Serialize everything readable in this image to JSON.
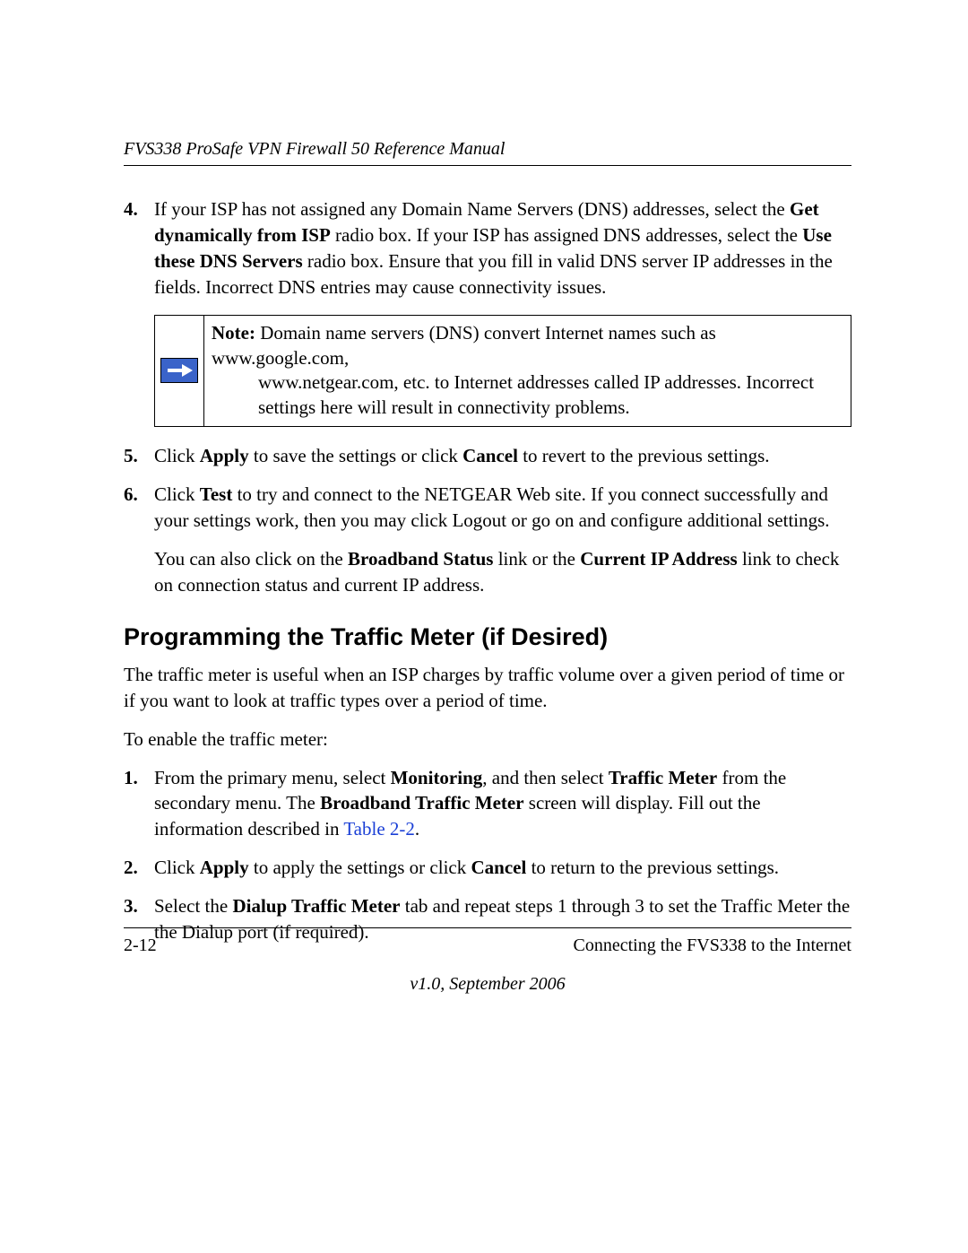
{
  "header": {
    "running_title": "FVS338 ProSafe VPN Firewall 50 Reference Manual"
  },
  "steps_a": [
    {
      "num": "4.",
      "pre1": "If your ISP has not assigned any Domain Name Servers (DNS) addresses, select the ",
      "b1": "Get dynamically from ISP",
      "mid1": " radio box. If your ISP has assigned DNS addresses, select the ",
      "b2": "Use these DNS Servers",
      "post1": " radio box. Ensure that you fill in valid DNS server IP addresses in the fields. Incorrect DNS entries may cause connectivity issues."
    }
  ],
  "note": {
    "label": "Note:",
    "line1": " Domain name servers (DNS) convert Internet names such as www.google.com,",
    "cont": "www.netgear.com, etc. to Internet addresses called IP addresses. Incorrect settings here will result in connectivity problems."
  },
  "steps_b": [
    {
      "num": "5.",
      "pre": "Click ",
      "b1": "Apply",
      "mid": " to save the settings or click ",
      "b2": "Cancel",
      "post": " to revert to the previous settings."
    },
    {
      "num": "6.",
      "pre": "Click ",
      "b1": "Test",
      "post": " to try and connect to the NETGEAR Web site. If you connect successfully and your settings work, then you may click Logout or go on and configure additional settings."
    }
  ],
  "follow6": {
    "pre": "You can also click on the ",
    "b1": "Broadband Status",
    "mid": " link or the ",
    "b2": "Current IP Address",
    "post": " link to check on connection status and current IP address."
  },
  "section_heading": "Programming the Traffic Meter (if Desired)",
  "section_intro": "The traffic meter is useful when an ISP charges by traffic volume over a given period of time or if you want to look at traffic types over a period of time.",
  "section_lead": "To enable the traffic meter:",
  "steps_c": [
    {
      "num": "1.",
      "pre": "From the primary menu, select ",
      "b1": "Monitoring",
      "mid1": ", and then select ",
      "b2": "Traffic Meter",
      "mid2": " from the secondary menu. The ",
      "b3": "Broadband Traffic Meter",
      "mid3": " screen will display. Fill out the information described in ",
      "xref": "Table 2-2",
      "post": "."
    },
    {
      "num": "2.",
      "pre": "Click ",
      "b1": "Apply",
      "mid": " to apply the settings or click ",
      "b2": "Cancel",
      "post": " to return to the previous settings."
    },
    {
      "num": "3.",
      "pre": "Select the ",
      "b1": "Dialup Traffic Meter",
      "post": " tab and repeat steps 1 through 3 to set the Traffic Meter the the Dialup port (if required)."
    }
  ],
  "footer": {
    "page_num": "2-12",
    "chapter": "Connecting the FVS338 to the Internet",
    "version": "v1.0, September 2006"
  }
}
